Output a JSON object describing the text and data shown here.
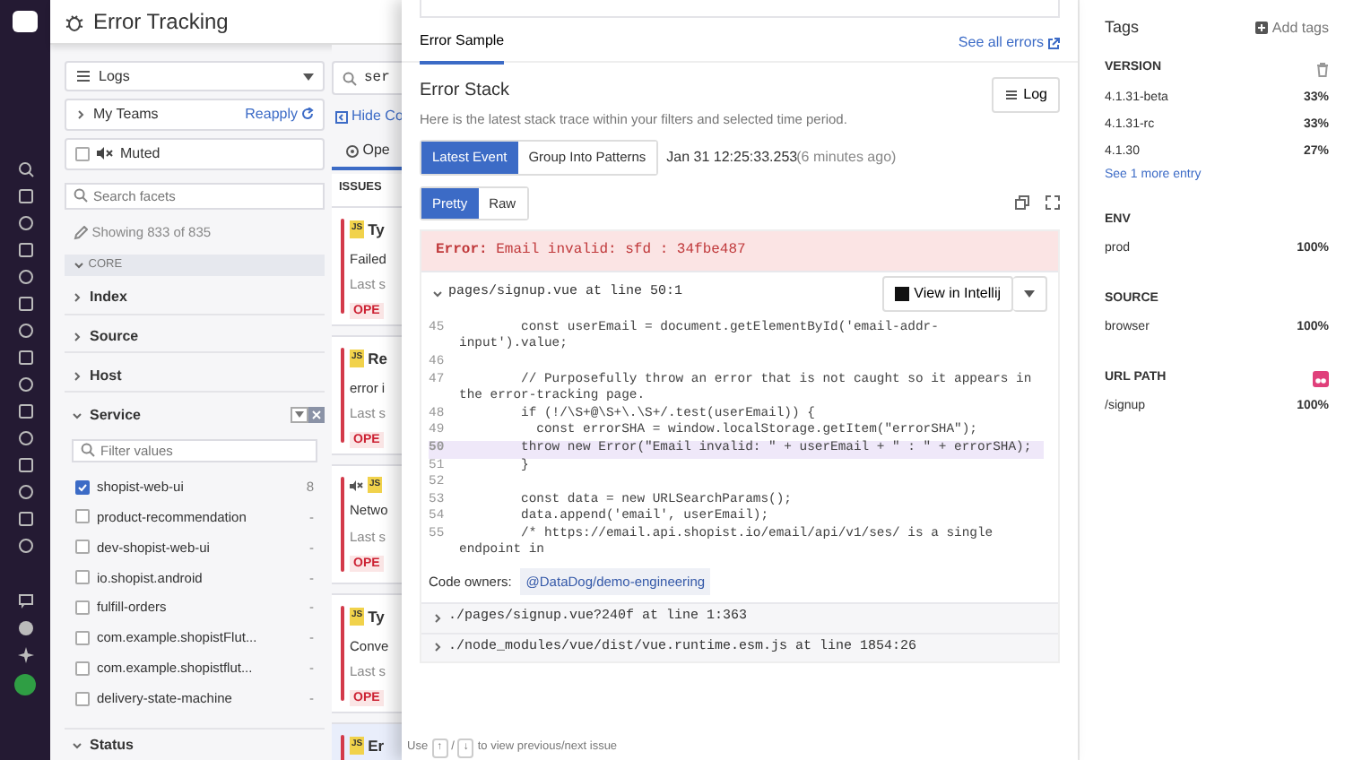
{
  "header": {
    "title": "Error Tracking"
  },
  "facets": {
    "source_select": "Logs",
    "my_teams": {
      "label": "My Teams",
      "action": "Reapply"
    },
    "muted": {
      "label": "Muted",
      "checked": false
    },
    "search": {
      "placeholder": "Search facets"
    },
    "showing": "Showing 833 of 835",
    "group": {
      "label": "CORE",
      "expanded": true
    },
    "sections": [
      {
        "label": "Index",
        "expanded": false
      },
      {
        "label": "Source",
        "expanded": false
      },
      {
        "label": "Host",
        "expanded": false
      },
      {
        "label": "Service",
        "expanded": true
      }
    ],
    "service_filter": {
      "placeholder": "Filter values"
    },
    "service_values": [
      {
        "label": "shopist-web-ui",
        "count": "8",
        "checked": true
      },
      {
        "label": "product-recommendation",
        "count": "-",
        "checked": false
      },
      {
        "label": "dev-shopist-web-ui",
        "count": "-",
        "checked": false
      },
      {
        "label": "io.shopist.android",
        "count": "-",
        "checked": false
      },
      {
        "label": "fulfill-orders",
        "count": "-",
        "checked": false
      },
      {
        "label": "com.example.shopistFlut...",
        "count": "-",
        "checked": false
      },
      {
        "label": "com.example.shopistflut...",
        "count": "-",
        "checked": false
      },
      {
        "label": "delivery-state-machine",
        "count": "-",
        "checked": false
      }
    ],
    "status": {
      "label": "Status",
      "expanded": true
    }
  },
  "issues": {
    "search": "ser",
    "hide": "Hide Co",
    "tab": "Ope",
    "heading": "ISSUES",
    "items": [
      {
        "badge": "JS",
        "title": "Ty",
        "subtitle": "Failed",
        "seen": "Last s",
        "status": "OPE",
        "muted": false,
        "selected": false
      },
      {
        "badge": "JS",
        "title": "Re",
        "subtitle": "error i",
        "seen": "Last s",
        "status": "OPE",
        "muted": false,
        "selected": false
      },
      {
        "badge": "JS",
        "subtitle": "Netwo",
        "seen": "Last s",
        "status": "OPE",
        "muted": true,
        "selected": false
      },
      {
        "badge": "JS",
        "title": "Ty",
        "subtitle": "Conve",
        "seen": "Last s",
        "status": "OPE",
        "muted": false,
        "selected": false
      },
      {
        "badge": "JS",
        "title": "Er",
        "muted": false,
        "selected": true
      }
    ]
  },
  "drawer": {
    "tab": {
      "label": "Error Sample",
      "selected": true
    },
    "see_all": "See all errors",
    "stack": {
      "title": "Error Stack",
      "description": "Here is the latest stack trace within your filters and selected time period.",
      "log_button": "Log",
      "modes": [
        {
          "label": "Latest Event",
          "selected": true
        },
        {
          "label": "Group Into Patterns",
          "selected": false
        }
      ],
      "timestamp": "Jan 31 12:25:33.253",
      "relative": "(6 minutes ago)",
      "views": [
        {
          "label": "Pretty",
          "selected": true
        },
        {
          "label": "Raw",
          "selected": false
        }
      ],
      "error": "**Error:** Email invalid: sfd : 34fbe487",
      "frames": [
        {
          "path": "pages/signup.vue at line 50:1",
          "expanded": true,
          "ide_button": "View in Intellij",
          "lines": [
            {
              "number": "45",
              "code": "        const userEmail = document.getElementById('email-addr-input').value;",
              "highlighted": false
            },
            {
              "number": "46",
              "highlighted": false
            },
            {
              "number": "47",
              "code": "        // Purposefully throw an error that is not caught so it appears in the error-tracking page.",
              "highlighted": false
            },
            {
              "number": "48",
              "code": "        if (!/\\S+@\\S+\\.\\S+/.test(userEmail)) {",
              "highlighted": false
            },
            {
              "number": "49",
              "code": "          const errorSHA = window.localStorage.getItem(\"errorSHA\");",
              "highlighted": false
            },
            {
              "number": "50",
              "code": "        throw new Error(\"Email invalid: \" + userEmail + \" : \" + errorSHA);",
              "highlighted": true
            },
            {
              "number": "51",
              "code": "        }",
              "highlighted": false
            },
            {
              "number": "52",
              "highlighted": false
            },
            {
              "number": "53",
              "code": "        const data = new URLSearchParams();",
              "highlighted": false
            },
            {
              "number": "54",
              "code": "        data.append('email', userEmail);",
              "highlighted": false
            },
            {
              "number": "55",
              "code": "        /* https://email.api.shopist.io/email/api/v1/ses/ is a single endpoint in",
              "highlighted": false
            }
          ],
          "owners_label": "Code owners:",
          "owner": "@DataDog/demo-engineering"
        },
        {
          "path": "./pages/signup.vue?240f at line 1:363",
          "expanded": false
        },
        {
          "path": "./node_modules/vue/dist/vue.runtime.esm.js at line 1854:26",
          "expanded": false
        }
      ]
    },
    "footer": {
      "prefix": "Use",
      "up_key": "↑",
      "separator": "/",
      "down_key": "↓",
      "suffix": "to view previous/next issue"
    }
  },
  "tags": {
    "title": "Tags",
    "add": "Add tags",
    "groups": [
      {
        "name": "VERSION",
        "kind": "deletable",
        "entries": [
          {
            "value": "4.1.31-beta",
            "share": "33%"
          },
          {
            "value": "4.1.31-rc",
            "share": "33%"
          },
          {
            "value": "4.1.30",
            "share": "27%"
          }
        ],
        "more": "See 1 more entry"
      },
      {
        "name": "ENV",
        "kind": "plain",
        "entries": [
          {
            "value": "prod",
            "share": "100%"
          }
        ]
      },
      {
        "name": "SOURCE",
        "kind": "plain",
        "entries": [
          {
            "value": "browser",
            "share": "100%"
          }
        ]
      },
      {
        "name": "URL PATH",
        "kind": "linked",
        "entries": [
          {
            "value": "/signup",
            "share": "100%"
          }
        ]
      }
    ]
  }
}
